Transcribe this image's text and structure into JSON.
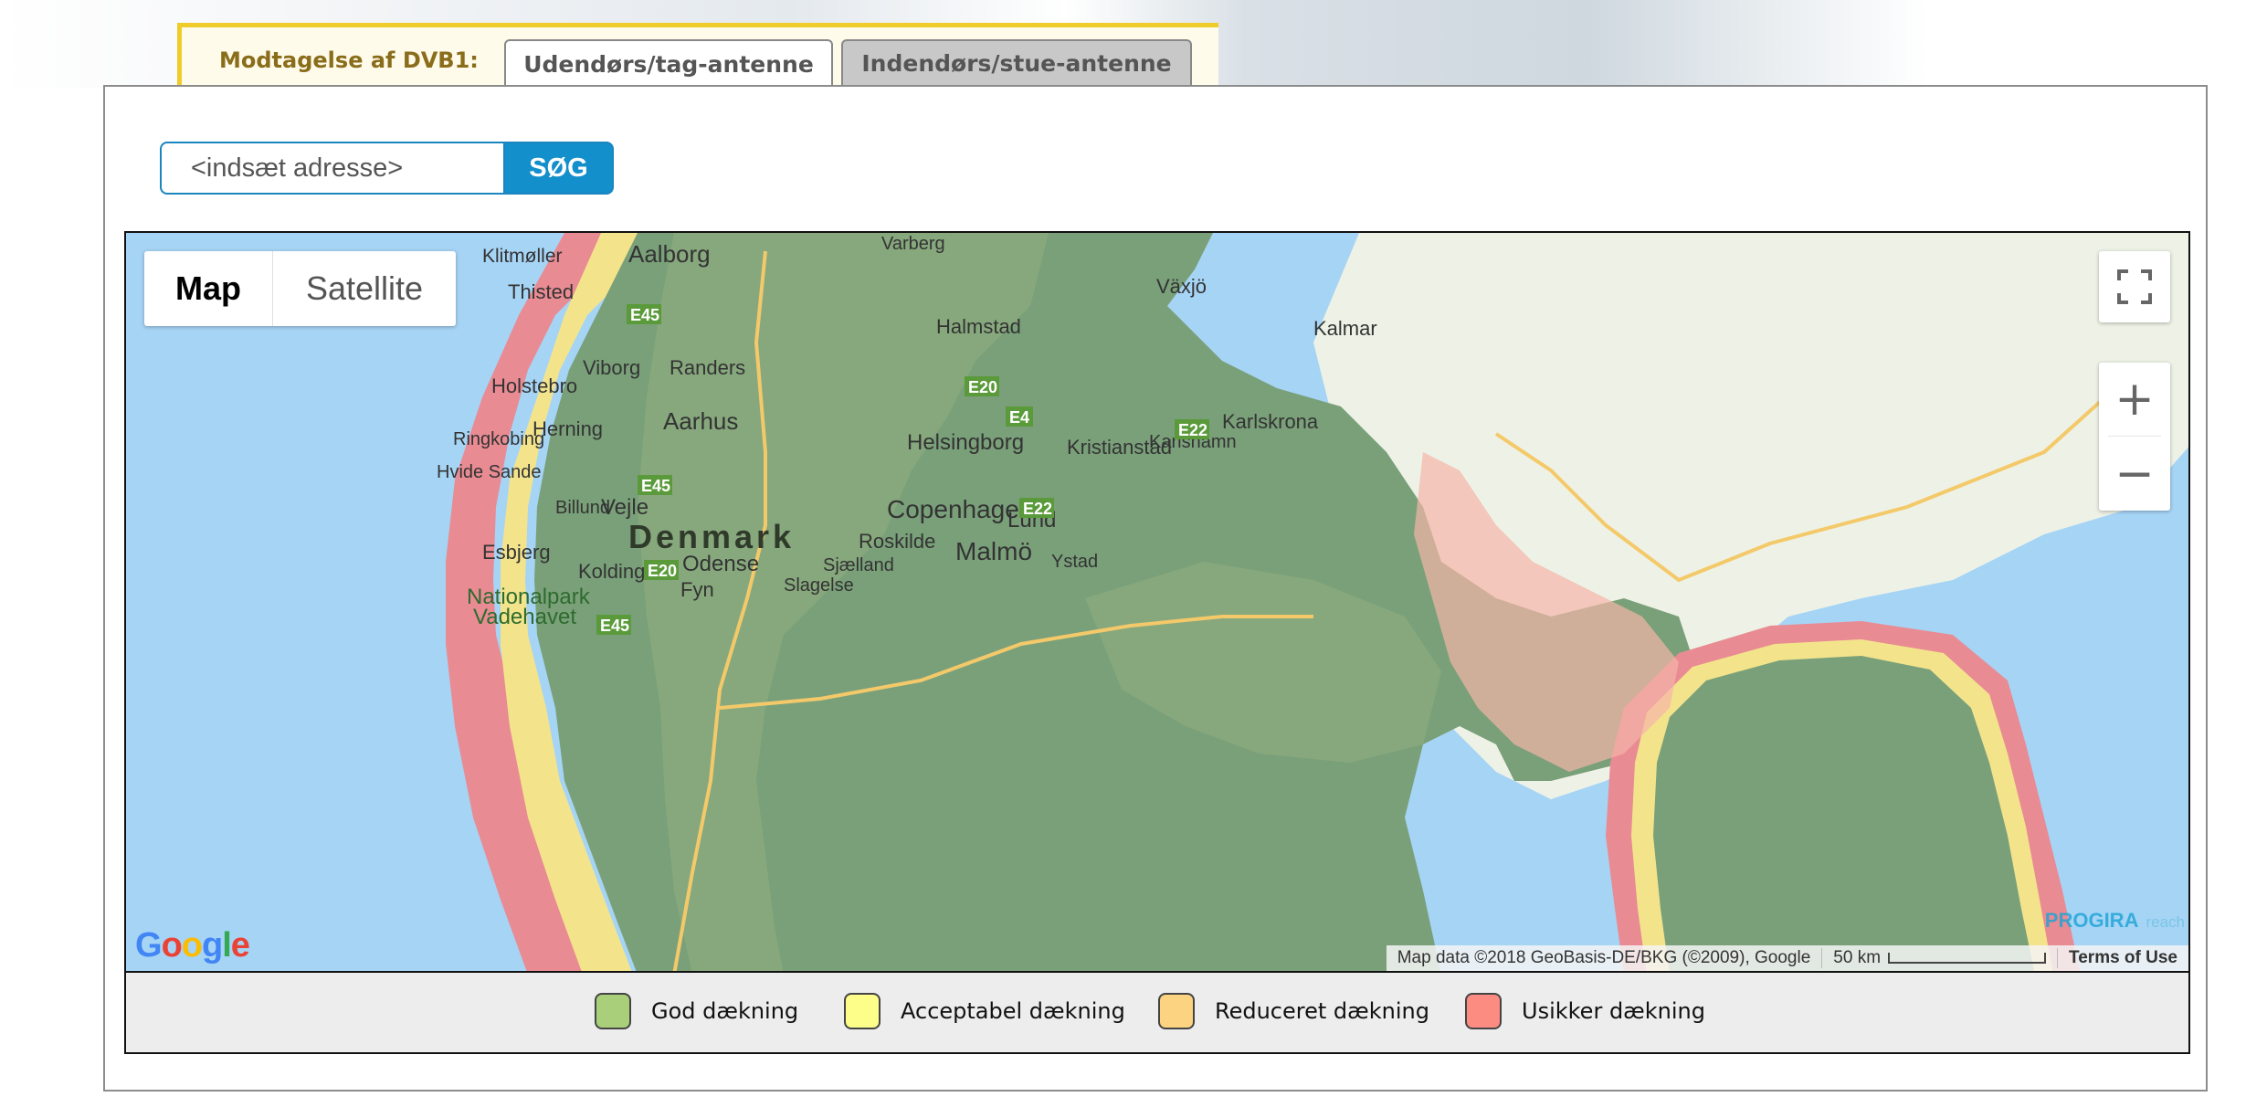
{
  "tabs": {
    "label": "Modtagelse af DVB1:",
    "items": [
      {
        "label": "Udendørs/tag-antenne",
        "active": true
      },
      {
        "label": "Indendørs/stue-antenne",
        "active": false
      }
    ]
  },
  "search": {
    "placeholder": "<indsæt adresse>",
    "button_label": "SØG"
  },
  "map": {
    "type_control": {
      "map": "Map",
      "satellite": "Satellite"
    },
    "fullscreen_icon": "fullscreen-icon",
    "zoom_in": "+",
    "zoom_out": "−",
    "attribution": "Map data ©2018 GeoBasis-DE/BKG (©2009), Google",
    "scale": "50 km",
    "terms": "Terms of Use",
    "google_logo": "Google",
    "brand": "PROGIRA",
    "brand_suffix": "reach",
    "places": {
      "country": "Denmark",
      "aalborg": "Aalborg",
      "klitmoller": "Klitmøller",
      "thisted": "Thisted",
      "viborg": "Viborg",
      "randers": "Randers",
      "holstebro": "Holstebro",
      "aarhus": "Aarhus",
      "herning": "Herning",
      "ringkobing": "Ringkobing",
      "hvide_sande": "Hvide Sande",
      "billund": "Billund",
      "vejle": "Vejle",
      "esbjerg": "Esbjerg",
      "kolding": "Kolding",
      "odense": "Odense",
      "fyn": "Fyn",
      "nationalpark": "Nationalpark",
      "vadehavet": "Vadehavet",
      "varberg": "Varberg",
      "halmstad": "Halmstad",
      "vaxjo": "Växjö",
      "kalmar": "Kalmar",
      "karlskrona": "Karlskrona",
      "karlshamn": "Karlshamn",
      "kristianstad": "Kristianstad",
      "helsingborg": "Helsingborg",
      "copenhagen": "Copenhagen",
      "lund": "Lund",
      "malmo": "Malmö",
      "roskilde": "Roskilde",
      "sjaelland": "Sjælland",
      "slagelse": "Slagelse",
      "ystad": "Ystad"
    },
    "roads": {
      "e45": "E45",
      "e20": "E20",
      "e4": "E4",
      "e22": "E22"
    }
  },
  "legend": {
    "items": [
      {
        "label": "God dækning",
        "color": "#a9cf7a"
      },
      {
        "label": "Acceptabel dækning",
        "color": "#fdfd8a"
      },
      {
        "label": "Reduceret dækning",
        "color": "#fcd380"
      },
      {
        "label": "Usikker dækning",
        "color": "#fc8c82"
      }
    ]
  },
  "colors": {
    "coverage_good": "#7aa07a",
    "water": "#a6d4f5",
    "land": "#eef2e6",
    "accent": "#138fcc",
    "tab_border": "#f0cc2a"
  }
}
